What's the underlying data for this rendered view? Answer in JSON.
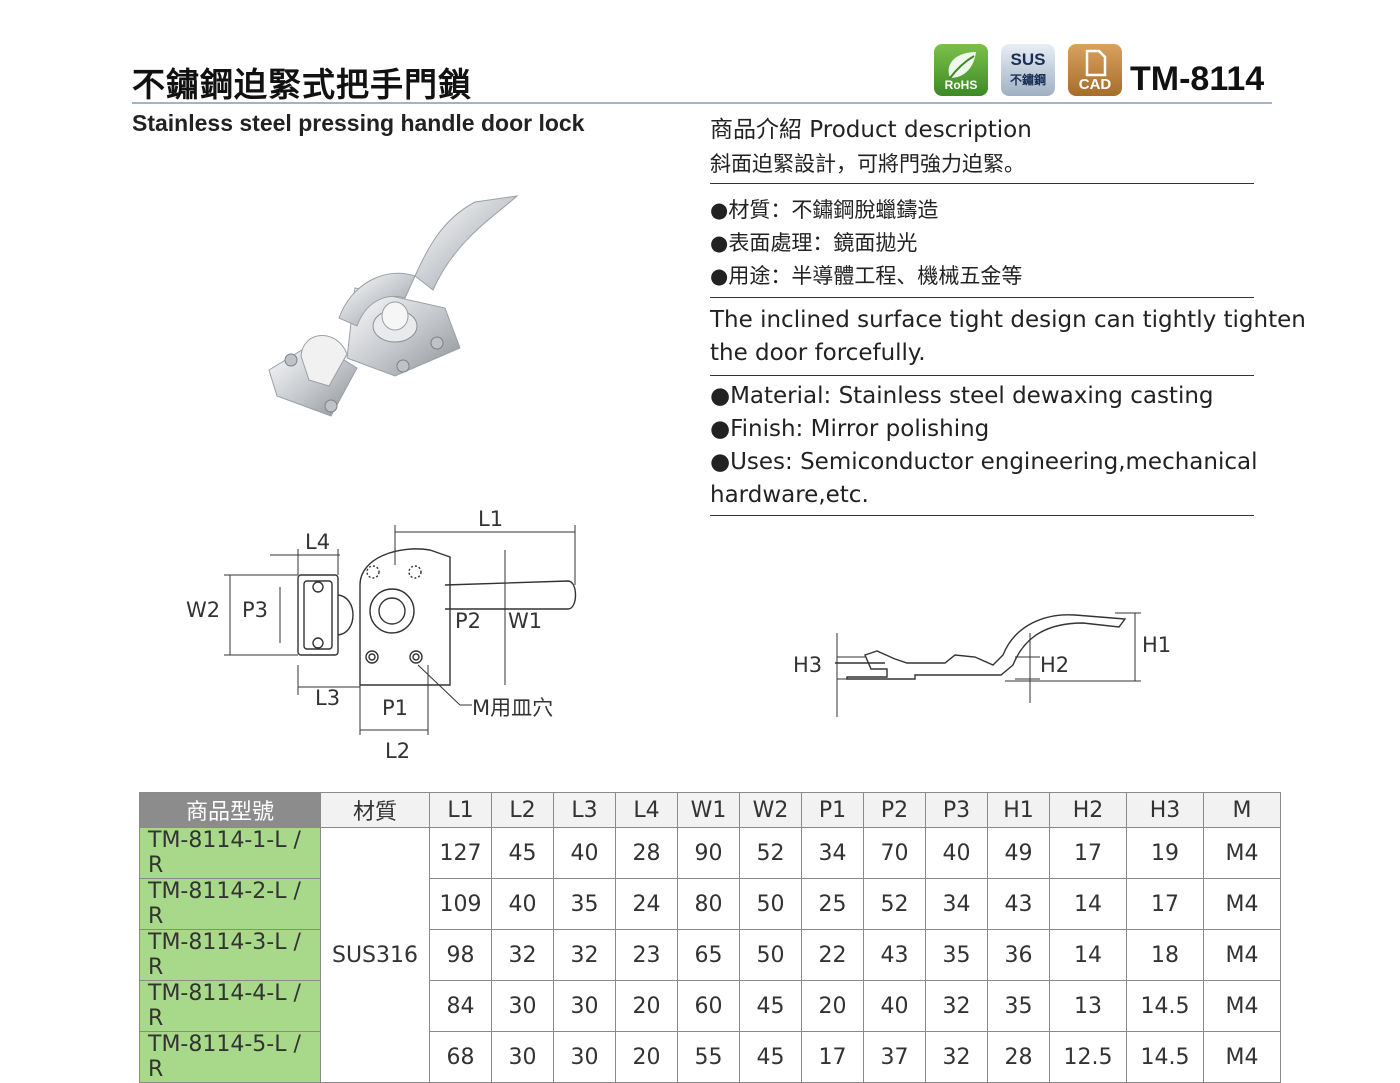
{
  "header": {
    "title_zh": "不鏽鋼迫緊式把手門鎖",
    "title_en": "Stainless steel pressing handle door lock",
    "model": "TM-8114"
  },
  "badges": {
    "rohs": "RoHS",
    "sus_top": "SUS",
    "sus_bottom": "不鏽鋼",
    "cad": "CAD"
  },
  "description": {
    "heading": "商品介紹 Product description",
    "zh_summary": "斜面迫緊設計，可將門強力迫緊。",
    "zh_bullets": [
      "●材質：不鏽鋼脫蠟鑄造",
      "●表面處理：鏡面拋光",
      "●用途：半導體工程、機械五金等"
    ],
    "en_summary": "The inclined surface tight design can tightly tighten the door forcefully.",
    "en_bullets": [
      "●Material: Stainless steel dewaxing casting",
      "●Finish: Mirror polishing",
      "●Uses: Semiconductor engineering,mechanical hardware,etc."
    ]
  },
  "diagram_labels": {
    "L1": "L1",
    "L2": "L2",
    "L3": "L3",
    "L4": "L4",
    "W1": "W1",
    "W2": "W2",
    "P1": "P1",
    "P2": "P2",
    "P3": "P3",
    "H1": "H1",
    "H2": "H2",
    "H3": "H3",
    "screw_note": "M用皿穴"
  },
  "colors": {
    "model_cell": "#a8d88a",
    "header_cell": "#8c8c8c",
    "rule": "#9fb4c9"
  },
  "table": {
    "headers": [
      "商品型號",
      "材質",
      "L1",
      "L2",
      "L3",
      "L4",
      "W1",
      "W2",
      "P1",
      "P2",
      "P3",
      "H1",
      "H2",
      "H3",
      "M"
    ],
    "material": "SUS316",
    "rows": [
      {
        "model": "TM-8114-1-L / R",
        "values": [
          "127",
          "45",
          "40",
          "28",
          "90",
          "52",
          "34",
          "70",
          "40",
          "49",
          "17",
          "19",
          "M4"
        ]
      },
      {
        "model": "TM-8114-2-L / R",
        "values": [
          "109",
          "40",
          "35",
          "24",
          "80",
          "50",
          "25",
          "52",
          "34",
          "43",
          "14",
          "17",
          "M4"
        ]
      },
      {
        "model": "TM-8114-3-L / R",
        "values": [
          "98",
          "32",
          "32",
          "23",
          "65",
          "50",
          "22",
          "43",
          "35",
          "36",
          "14",
          "18",
          "M4"
        ]
      },
      {
        "model": "TM-8114-4-L / R",
        "values": [
          "84",
          "30",
          "30",
          "20",
          "60",
          "45",
          "20",
          "40",
          "32",
          "35",
          "13",
          "14.5",
          "M4"
        ]
      },
      {
        "model": "TM-8114-5-L / R",
        "values": [
          "68",
          "30",
          "30",
          "20",
          "55",
          "45",
          "17",
          "37",
          "32",
          "28",
          "12.5",
          "14.5",
          "M4"
        ]
      }
    ]
  }
}
